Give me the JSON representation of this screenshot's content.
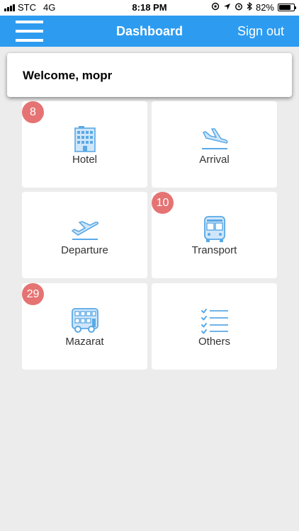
{
  "status_bar": {
    "carrier": "STC",
    "network": "4G",
    "time": "8:18 PM",
    "battery": "82%",
    "battery_level": 0.82
  },
  "nav": {
    "title": "Dashboard",
    "sign_out": "Sign out"
  },
  "welcome": {
    "text": "Welcome, mopr"
  },
  "tiles": [
    {
      "label": "Hotel",
      "badge": "8",
      "icon": "hotel-building-icon"
    },
    {
      "label": "Arrival",
      "badge": "",
      "icon": "plane-landing-icon"
    },
    {
      "label": "Departure",
      "badge": "",
      "icon": "plane-departure-icon"
    },
    {
      "label": "Transport",
      "badge": "10",
      "icon": "bus-icon"
    },
    {
      "label": "Mazarat",
      "badge": "29",
      "icon": "double-decker-bus-icon"
    },
    {
      "label": "Others",
      "badge": "",
      "icon": "checklist-icon"
    }
  ],
  "colors": {
    "primary": "#2d9cf0",
    "badge": "#e57373",
    "background": "#ececec",
    "icon": "#5aa9e6"
  }
}
